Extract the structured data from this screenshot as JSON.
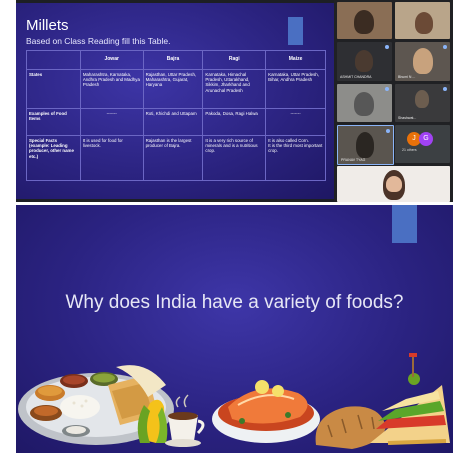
{
  "slide1": {
    "title": "Millets",
    "subtitle": "Based on Class Reading fill this Table.",
    "table": {
      "headers": [
        "",
        "Jowar",
        "Bajra",
        "Ragi",
        "Maize"
      ],
      "rows": [
        {
          "label": "States",
          "cells": [
            "Maharashtra, Karnataka, Andhra Pradesh and Madhya Pradesh",
            "Rajasthan, Uttar Pradesh, Maharashtra, Gujarat, Haryana",
            "Karnataka, Himachal Pradesh, Uttarakhand, Sikkim, Jharkhand and Arunachal Pradesh",
            "Karnataka, Uttar Pradesh, Bihar, Andhra Pradesh"
          ]
        },
        {
          "label": "Examples of Food Items",
          "cells": [
            "-------",
            "Roti, Khichdi and Uttapam",
            "Pakoda, Dosa, Ragi Halwa",
            "-------"
          ]
        },
        {
          "label": "Special Facts (example: Leading producer, other name etc.)",
          "cells": [
            "It is used for food for livestock.",
            "Rajasthan is the largest producer of Bajra.",
            "It is a very rich source of minerals and is a nutritious crop.",
            "It is also called Corn.\nIt is the third most important crop."
          ]
        }
      ]
    }
  },
  "participants": {
    "tiles": [
      {
        "name": ""
      },
      {
        "name": ""
      },
      {
        "name": "ASHMIT CHANDRA"
      },
      {
        "name": "Bhumi N ..."
      },
      {
        "name": ""
      },
      {
        "name": "Shashwat..."
      },
      {
        "name": "PRANAV TYAG"
      },
      {
        "name": ""
      }
    ],
    "more_avatars": [
      "J",
      "G"
    ],
    "more_label": "21 others"
  },
  "slide2": {
    "question": "Why does India have a variety of foods?"
  },
  "colors": {
    "slide_bg": "#2b2382",
    "accent_block": "#4a6fc2",
    "avatar_j": "#e8710a",
    "avatar_g": "#a142f4"
  }
}
